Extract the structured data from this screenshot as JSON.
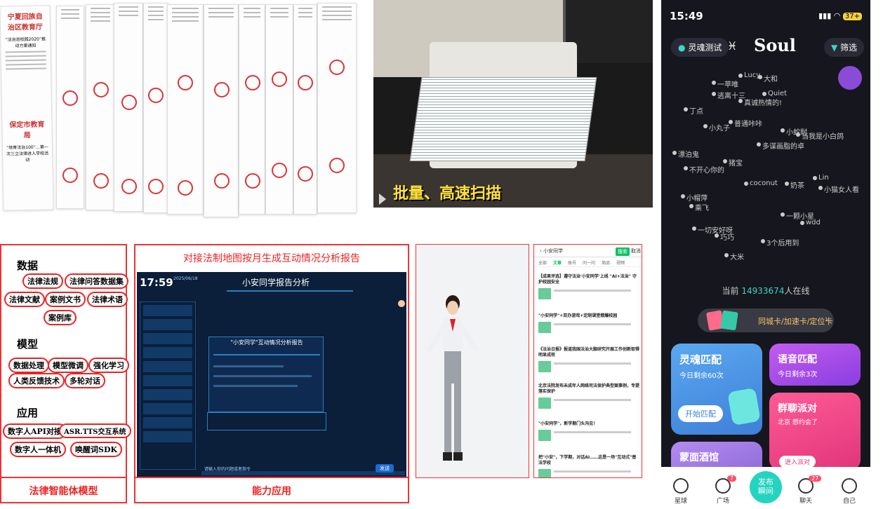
{
  "docs": {
    "header_titles": [
      "宁夏回族自治区教育厅",
      "保定市教育局"
    ],
    "header_sub": [
      "“法治进校园2020”推动方案通知",
      "“培育法治100”…第一次三立法律进入学校活动"
    ]
  },
  "scan": {
    "caption": "批量、高速扫描"
  },
  "soul": {
    "time": "15:49",
    "battery": "37+",
    "test_label": "灵魂测试",
    "logo": "Soul",
    "filter_label": "筛选",
    "planet_names": [
      "一苹唯",
      "Lucy",
      "大和",
      "逃离十三",
      "Quiet",
      "真诚热情的!",
      "丁点",
      "小丸子",
      "普通咔咔",
      "小蛇耐",
      "当我是小白鸽",
      "多谋画脂的卓",
      "漂泊鬼",
      "不开心你的",
      "猪宝",
      "coconut",
      "奶茶",
      "Lin",
      "小猫女人看",
      "小帽萍",
      "乘飞",
      "巧巧",
      "大米",
      "3个后用到",
      "wdd",
      "一颗小星",
      "一切安好呀"
    ],
    "online_prefix": "当前",
    "online_count": "14933674",
    "online_suffix": "人在线",
    "promo": "同城卡/加速卡/定位卡",
    "cards": {
      "soul_match": {
        "title": "灵魂匹配",
        "sub": "今日剩余60次",
        "button": "开始匹配"
      },
      "voice_match": {
        "title": "语音匹配",
        "sub": "今日剩余3次"
      },
      "group": {
        "title": "群聊派对",
        "sub": "北京 想约会了",
        "button": "进入派对"
      },
      "bar": {
        "title": "蒙面酒馆"
      }
    },
    "nav": [
      "星球",
      "广场",
      "聊天",
      "自己"
    ],
    "publish": [
      "发布",
      "瞬间"
    ],
    "badges": [
      "7",
      "27"
    ]
  },
  "legal": {
    "data_title": "数据",
    "data_tags": [
      "法律法规",
      "法律问答数据集",
      "法律文献",
      "案例文书",
      "法律术语",
      "案例库"
    ],
    "model_title": "模型",
    "model_tags": [
      "数据处理",
      "模型微调",
      "强化学习",
      "人类反馈技术",
      "多轮对话"
    ],
    "app_title": "应用",
    "app_tags": [
      "数字人API对接",
      "ASR.TTS交互系统",
      "数字人一体机",
      "唤醒词SDK"
    ],
    "caption": "法律智能体模型"
  },
  "app": {
    "title": "对接法制地图按月生成互动情况分析报告",
    "time": "17:59",
    "date": "2025/06/18",
    "header": "小安同学报告分析",
    "report_title": "\"小安同学\"互动情况分析报告",
    "input_placeholder": "请输入你的问题或者指令",
    "send": "发送",
    "caption": "能力应用"
  },
  "list": {
    "header": "小安同学",
    "search_btn": "搜索",
    "cancel": "取消",
    "tabs": [
      "全部",
      "文章",
      "账号",
      "问一问",
      "商品",
      "视频"
    ],
    "items": [
      "【成果评选】遵守法治'小安同学'上线 \"AI+法治\" 守护校园安全",
      "\"小安同学\"+双办游戏+定制课堂燃爆校园",
      "《法治日报》报道我国法治大脑研究开展工作创新取得明显成效",
      "北京法院发布未成年人网络司法保护典型案事例，专提落实保护",
      "\"小安同学\"，新学期门头沟见！",
      "把\"小安\"，下学期，对话AI……这是一场\"互动式\"普法学校"
    ]
  }
}
